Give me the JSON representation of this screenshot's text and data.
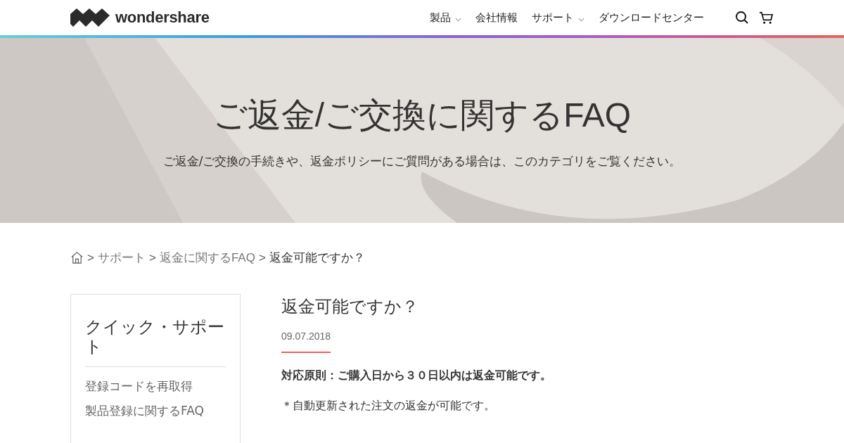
{
  "header": {
    "logo": "wondershare",
    "nav": [
      {
        "label": "製品",
        "has_menu": true
      },
      {
        "label": "会社情報",
        "has_menu": false
      },
      {
        "label": "サポート",
        "has_menu": true
      },
      {
        "label": "ダウンロードセンター",
        "has_menu": false
      }
    ]
  },
  "hero": {
    "kind": "picture",
    "title": "ご返金/ご交換に関するFAQ",
    "subtitle": "ご返金/ご交換の手続きや、返金ポリシーにご質問がある場合は、このカテゴリをご覧ください。"
  },
  "breadcrumb": {
    "separator": ">",
    "links": [
      "サポート",
      "返金に関するFAQ"
    ],
    "current": "返金可能ですか？"
  },
  "sidebar": {
    "title": "クイック・サポート",
    "links": [
      "登録コードを再取得",
      "製品登録に関するFAQ"
    ]
  },
  "article": {
    "title": "返金可能ですか？",
    "date": "09.07.2018",
    "paragraphs": [
      {
        "text": "対応原則：ご購入日から３０日以内は返金可能です。",
        "bold": true
      },
      {
        "text": "＊自動更新された注文の返金が可能です。",
        "bold": false
      }
    ]
  }
}
